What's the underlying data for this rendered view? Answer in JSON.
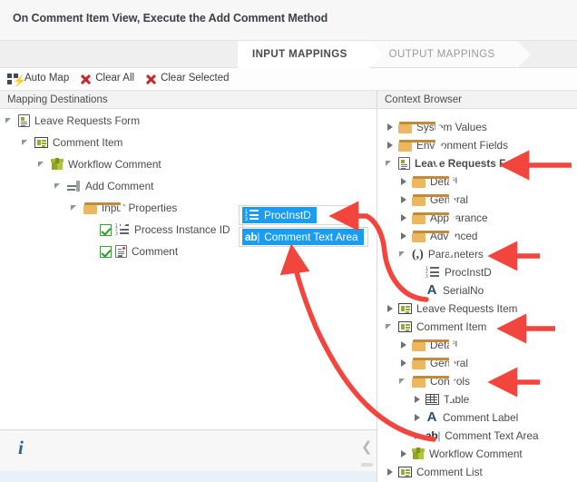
{
  "header": {
    "title": "On Comment Item View, Execute the Add Comment Method"
  },
  "tabs": [
    {
      "label": "INPUT MAPPINGS",
      "active": true
    },
    {
      "label": "OUTPUT MAPPINGS",
      "active": false
    }
  ],
  "toolbar": {
    "auto_map_label": "Auto Map",
    "clear_all_label": "Clear All",
    "clear_selected_label": "Clear Selected",
    "icons": [
      "automap-icon",
      "clear-all-x-icon",
      "clear-selected-x-icon"
    ]
  },
  "columns": {
    "left_header": "Mapping Destinations",
    "right_header": "Context Browser"
  },
  "mapping_tree": [
    {
      "label": "Leave Requests Form",
      "icon": "form-icon",
      "depth": 0,
      "twisty": "expanded"
    },
    {
      "label": "Comment Item",
      "icon": "view-icon",
      "depth": 1,
      "twisty": "expanded"
    },
    {
      "label": "Workflow Comment",
      "icon": "workflow-box-icon",
      "depth": 2,
      "twisty": "expanded"
    },
    {
      "label": "Add Comment",
      "icon": "method-icon",
      "depth": 3,
      "twisty": "expanded"
    },
    {
      "label": "Input Properties",
      "icon": "folder-icon",
      "depth": 4,
      "twisty": "expanded"
    },
    {
      "label": "Process Instance ID",
      "icon": "number-list-icon",
      "depth": 5,
      "twisty": "none",
      "checkbox": true,
      "required_star": "★"
    },
    {
      "label": "Comment",
      "icon": "comment-doc-icon",
      "depth": 5,
      "twisty": "none",
      "checkbox": true
    }
  ],
  "mapping_values": [
    {
      "value": "ProcInstD",
      "icon": "number-list-icon"
    },
    {
      "value": "Comment Text Area",
      "icon": "textarea-ab-icon"
    }
  ],
  "context_tree": [
    {
      "label": "System Values",
      "icon": "folder-icon",
      "depth": 0,
      "twisty": "collapsed"
    },
    {
      "label": "Environment Fields",
      "icon": "folder-icon",
      "depth": 0,
      "twisty": "collapsed"
    },
    {
      "label": "Leave Requests Form",
      "icon": "form-icon",
      "depth": 0,
      "twisty": "expanded",
      "bold": true
    },
    {
      "label": "Detail",
      "icon": "folder-icon",
      "depth": 1,
      "twisty": "collapsed"
    },
    {
      "label": "General",
      "icon": "folder-icon",
      "depth": 1,
      "twisty": "collapsed"
    },
    {
      "label": "Appearance",
      "icon": "folder-icon",
      "depth": 1,
      "twisty": "collapsed"
    },
    {
      "label": "Advanced",
      "icon": "folder-icon",
      "depth": 1,
      "twisty": "collapsed"
    },
    {
      "label": "Parameters",
      "icon": "parameters-icon",
      "depth": 1,
      "twisty": "expanded"
    },
    {
      "label": "ProcInstD",
      "icon": "number-list-icon",
      "depth": 2,
      "twisty": "none"
    },
    {
      "label": "SerialNo",
      "icon": "text-a-icon",
      "depth": 2,
      "twisty": "none"
    },
    {
      "label": "Leave Requests Item",
      "icon": "view-icon",
      "depth": 0,
      "twisty": "collapsed"
    },
    {
      "label": "Comment Item",
      "icon": "view-icon",
      "depth": 0,
      "twisty": "expanded"
    },
    {
      "label": "Detail",
      "icon": "folder-icon",
      "depth": 1,
      "twisty": "collapsed"
    },
    {
      "label": "General",
      "icon": "folder-icon",
      "depth": 1,
      "twisty": "collapsed"
    },
    {
      "label": "Controls",
      "icon": "folder-icon",
      "depth": 1,
      "twisty": "expanded"
    },
    {
      "label": "Table",
      "icon": "table-icon",
      "depth": 2,
      "twisty": "collapsed"
    },
    {
      "label": "Comment Label",
      "icon": "text-a-icon",
      "depth": 2,
      "twisty": "collapsed"
    },
    {
      "label": "Comment Text Area",
      "icon": "textarea-ab-icon",
      "depth": 2,
      "twisty": "collapsed"
    },
    {
      "label": "Workflow Comment",
      "icon": "workflow-box-icon",
      "depth": 1,
      "twisty": "collapsed"
    },
    {
      "label": "Comment List",
      "icon": "view-icon",
      "depth": 0,
      "twisty": "collapsed"
    }
  ],
  "footer": {
    "info_icon": "information-icon",
    "collapse_icon": "chevron-left-icon"
  },
  "annotations": {
    "arrow_color": "#f2453d",
    "arrows": [
      {
        "name": "arrow-to-leave-requests-form",
        "target": "Leave Requests Form"
      },
      {
        "name": "arrow-to-parameters",
        "target": "Parameters"
      },
      {
        "name": "arrow-to-comment-item",
        "target": "Comment Item"
      },
      {
        "name": "arrow-to-controls",
        "target": "Controls"
      },
      {
        "name": "arrow-procinstd-to-mapping",
        "target": "ProcInstD"
      },
      {
        "name": "arrow-comment-text-area-to-mapping",
        "target": "Comment Text Area"
      }
    ]
  },
  "colors": {
    "accent_red": "#e8413b",
    "selection_blue": "#1a9cf0",
    "folder_tan": "#edb761",
    "workflow_olive": "#a8b830"
  }
}
